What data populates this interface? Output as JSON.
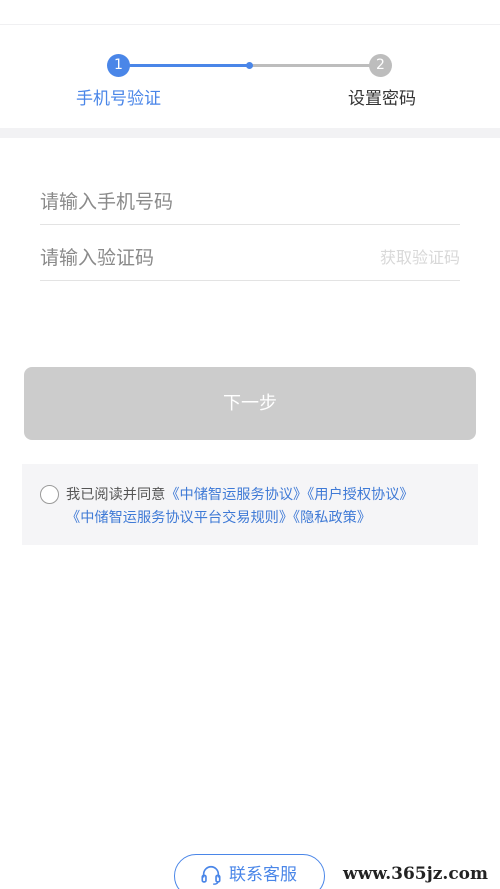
{
  "stepper": {
    "steps": [
      {
        "number": "1",
        "label": "手机号验证",
        "state": "active"
      },
      {
        "number": "2",
        "label": "设置密码",
        "state": "inactive"
      }
    ],
    "active_color": "#4a86e8",
    "inactive_color": "#bdbdbd"
  },
  "form": {
    "phone_placeholder": "请输入手机号码",
    "code_placeholder": "请输入验证码",
    "get_code_label": "获取验证码"
  },
  "next_button": {
    "label": "下一步",
    "enabled": false,
    "color": "#cccccc"
  },
  "agreement": {
    "prefix": "我已阅读并同意",
    "links": [
      "《中储智运服务协议》",
      "《用户授权协议》",
      "《中储智运服务协议平台交易规则》",
      "《隐私政策》"
    ],
    "link_color": "#3f7ad6",
    "checked": false
  },
  "contact": {
    "label": "联系客服",
    "icon": "headset-icon"
  },
  "watermark": {
    "text": "www.365jz.com"
  }
}
